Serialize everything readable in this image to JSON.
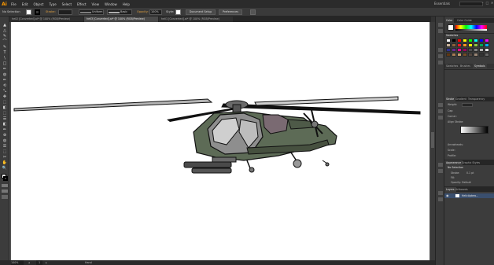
{
  "app": {
    "logo": "Ai"
  },
  "menu": [
    "File",
    "Edit",
    "Object",
    "Type",
    "Select",
    "Effect",
    "View",
    "Window",
    "Help"
  ],
  "workspace": "Essentials",
  "window_controls": [
    "–",
    "□",
    "✕"
  ],
  "control_bar": {
    "selection": "No Selection",
    "stroke_label": "Stroke:",
    "stroke_value": "",
    "profile": "Uniform",
    "brush": "Basic",
    "opacity_label": "Opacity:",
    "opacity_value": "100%",
    "style_label": "Style:",
    "doc_setup": "Document Setup",
    "preferences": "Preferences"
  },
  "tabs": [
    {
      "label": "heli2 [Converted].ai* @ 100% (RGB/Preview)",
      "active": false
    },
    {
      "label": "heli3 [Converted].ai* @ 100% (RGB/Preview)",
      "active": true
    },
    {
      "label": "heli1 [Converted].ai* @ 100% (RGB/Preview)",
      "active": false
    }
  ],
  "tools": [
    "▲",
    "△",
    "✎",
    "⌒",
    "T",
    "\\",
    "□",
    "✏",
    "◍",
    "⟲",
    "⤡",
    "✥",
    "⬚",
    "◧",
    "✂",
    "☰",
    "⊕",
    "✋",
    "🔍"
  ],
  "status": {
    "zoom": "100%",
    "page": "1",
    "mode": "Hand"
  },
  "panels": {
    "color_tabs": [
      "Color",
      "Color Guide"
    ],
    "swatch_tabs": [
      "Swatches",
      "Brushes",
      "Symbols"
    ],
    "swatch_colors": [
      "#ffffff",
      "#000000",
      "#ff0000",
      "#ffff00",
      "#00ff00",
      "#00ffff",
      "#0000ff",
      "#ff00ff",
      "#c7b299",
      "#8c6239",
      "#ed1c24",
      "#f7941d",
      "#fff200",
      "#8dc63f",
      "#00a651",
      "#00aeef",
      "#2e3192",
      "#662d91",
      "#ec008c",
      "#9e005d",
      "#4d4d4d",
      "#808080",
      "#b3b3b3",
      "#e6e6e6",
      "#603813",
      "#a67c52",
      "#c69c6d",
      "#754c24",
      "#534741",
      "#998675",
      "#333333",
      "#666666"
    ],
    "stroke_tabs": [
      "Stroke",
      "Gradient",
      "Transparency"
    ],
    "stroke_labels": [
      "Weight:",
      "Cap:",
      "Corner:",
      "Align Stroke:",
      "Dashed Line",
      "Arrowheads:",
      "Scale:",
      "Align:",
      "Profile:"
    ],
    "appearance_tabs": [
      "Appearance",
      "Graphic Styles"
    ],
    "appearance_title": "No Selection",
    "appearance_rows": [
      "Stroke:",
      "Fill:",
      "Opacity: Default"
    ],
    "stroke_weight": "0.1 pt",
    "layers_tabs": [
      "Layers",
      "Artboards"
    ],
    "layer_name": "Helicóptero..."
  }
}
